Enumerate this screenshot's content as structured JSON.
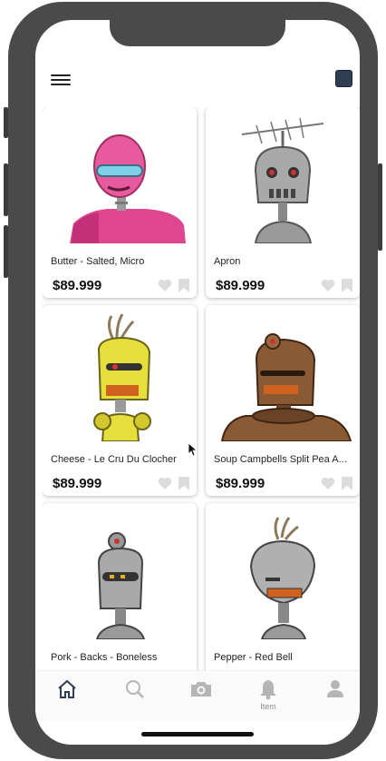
{
  "header": {
    "menu_icon": "hamburger-menu-icon",
    "profile_icon": "profile-square-icon",
    "profile_color": "#2f3d55"
  },
  "products": [
    {
      "title": "Butter - Salted, Micro",
      "price": "$89.999",
      "robot": "pink"
    },
    {
      "title": "Apron",
      "price": "$89.999",
      "robot": "antenna"
    },
    {
      "title": "Cheese - Le Cru Du Clocher",
      "price": "$89.999",
      "robot": "yellow"
    },
    {
      "title": "Soup Campbells Split Pea A...",
      "price": "$89.999",
      "robot": "brown"
    },
    {
      "title": "Pork - Backs - Boneless",
      "price": "",
      "robot": "gray-hat"
    },
    {
      "title": "Pepper - Red Bell",
      "price": "",
      "robot": "gray-dome"
    }
  ],
  "tabbar": {
    "tabs": [
      {
        "icon": "home-icon",
        "label": "",
        "active": true
      },
      {
        "icon": "search-icon",
        "label": "",
        "active": false
      },
      {
        "icon": "camera-icon",
        "label": "",
        "active": false
      },
      {
        "icon": "bell-icon",
        "label": "Item",
        "active": false
      },
      {
        "icon": "person-icon",
        "label": "",
        "active": false
      }
    ],
    "active_color": "#2f3d55",
    "inactive_color": "#b5b5b5"
  }
}
